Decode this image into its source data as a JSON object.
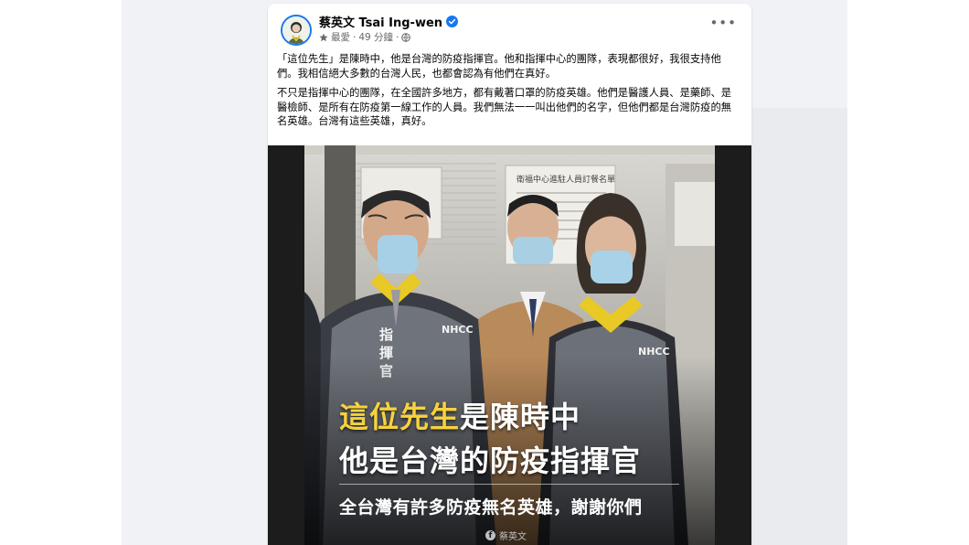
{
  "post": {
    "author_name": "蔡英文 Tsai Ing-wen",
    "meta": {
      "favorite_icon": "star-icon",
      "favorite_label": "最愛",
      "separator": "·",
      "time": "49 分鐘",
      "separator2": "·",
      "audience_icon": "globe-icon"
    },
    "more_label": "•••",
    "paragraph1": "「這位先生」是陳時中，他是台灣的防疫指揮官。他和指揮中心的團隊，表現都很好，我很支持他們。我相信絕大多數的台灣人民，也都會認為有他們在真好。",
    "paragraph2": "不只是指揮中心的團隊，在全國許多地方，都有戴著口罩的防疫英雄。他們是醫護人員、是藥師、是醫檢師、是所有在防疫第一線工作的人員。我們無法一一叫出他們的名字，但他們都是台灣防疫的無名英雄。台灣有這些英雄，真好。",
    "image": {
      "caption_line1_highlight": "這位先生",
      "caption_line1_rest": "是陳時中",
      "caption_line2": "他是台灣的防疫指揮官",
      "caption_line3": "全台灣有許多防疫無名英雄，謝謝你們",
      "vest_text_left": "NHCC",
      "vest_text_right": "NHCC",
      "vest_vertical_text": "指揮官",
      "sign_text": "衛福中心進駐人員訂餐名單",
      "watermark": "蔡英文"
    }
  },
  "colors": {
    "verified": "#1877f2",
    "caption_highlight": "#f7d23c",
    "vest_collar": "#e8c925"
  }
}
